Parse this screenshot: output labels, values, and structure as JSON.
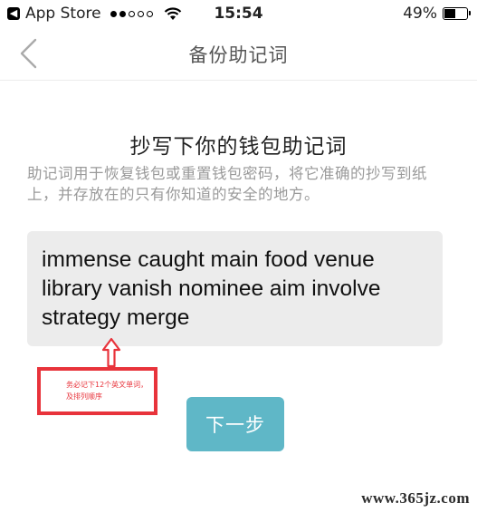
{
  "status_bar": {
    "back_app_label": "App Store",
    "signal_dots_filled": 2,
    "signal_dots_total": 5,
    "time": "15:54",
    "battery_percent_label": "49%",
    "battery_level": 0.49,
    "icons": [
      "back-triangle-icon",
      "signal-icon",
      "wifi-icon",
      "battery-icon"
    ]
  },
  "nav": {
    "back_icon": "chevron-left-icon",
    "title": "备份助记词"
  },
  "main": {
    "heading": "抄写下你的钱包助记词",
    "description": "助记词用于恢复钱包或重置钱包密码，将它准确的抄写到纸上，并存放在的只有你知道的安全的地方。",
    "mnemonic": "immense caught main food venue library vanish nominee aim involve strategy merge"
  },
  "annotation": {
    "note": "务必记下12个英文单词，及排列顺序",
    "arrow_icon": "arrow-up-icon",
    "color": "#e8333b"
  },
  "actions": {
    "next_label": "下一步",
    "next_color": "#5fb7c7"
  },
  "watermark": "www.365jz.com"
}
